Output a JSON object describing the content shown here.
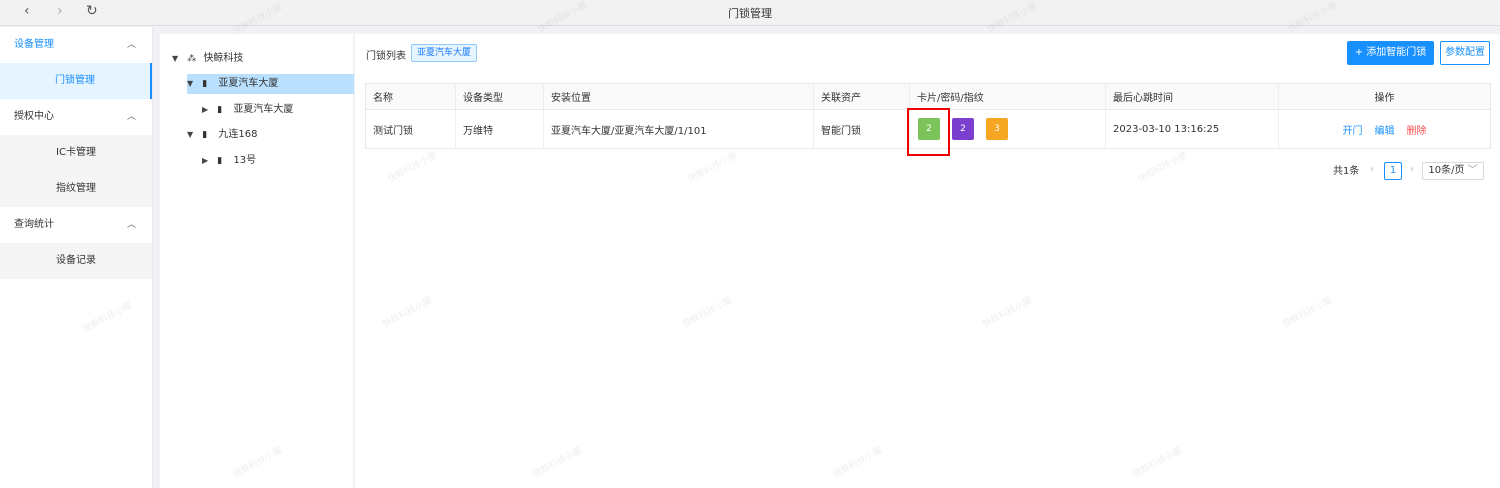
{
  "titlebar": {
    "back_icon": "‹",
    "forward_icon": "›",
    "refresh_icon": "↻",
    "title": "门锁管理"
  },
  "sidebar": {
    "groups": [
      {
        "label": "设备管理",
        "items": [
          {
            "label": "门锁管理",
            "active": true
          }
        ]
      },
      {
        "label": "授权中心",
        "items": [
          {
            "label": "IC卡管理"
          },
          {
            "label": "指纹管理"
          }
        ]
      },
      {
        "label": "查询统计",
        "items": [
          {
            "label": "设备记录"
          }
        ]
      }
    ]
  },
  "tree": {
    "root": "快鲸科技",
    "n1": "亚夏汽车大厦",
    "n1_child": "亚夏汽车大厦",
    "n2": "九连168",
    "n2_child": "13号"
  },
  "main": {
    "crumb": "门锁列表",
    "tag": "亚夏汽车大厦",
    "add_button": "+ 添加智能门锁",
    "config_button": "参数配置"
  },
  "table": {
    "headers": [
      "名称",
      "设备类型",
      "安装位置",
      "关联资产",
      "卡片/密码/指纹",
      "最后心跳时间",
      "操作"
    ],
    "rows": [
      {
        "name": "测试门锁",
        "type": "万维特",
        "location": "亚夏汽车大厦/亚夏汽车大厦/1/101",
        "asset": "智能门锁",
        "card_count": "2",
        "password_count": "2",
        "fingerprint_count": "3",
        "heartbeat": "2023-03-10 13:16:25",
        "actions": {
          "open": "开门",
          "edit": "编辑",
          "delete": "删除"
        }
      }
    ]
  },
  "pagination": {
    "total": "共1条",
    "prev": "‹",
    "page": "1",
    "next": "›",
    "page_size": "10条/页"
  },
  "colors": {
    "primary": "#1890ff",
    "card_badge": "#7cc35a",
    "password_badge": "#7b3fd0",
    "fingerprint_badge": "#f5a623",
    "delete": "#ff4d4f"
  },
  "watermark": "快鲸科技小屋"
}
